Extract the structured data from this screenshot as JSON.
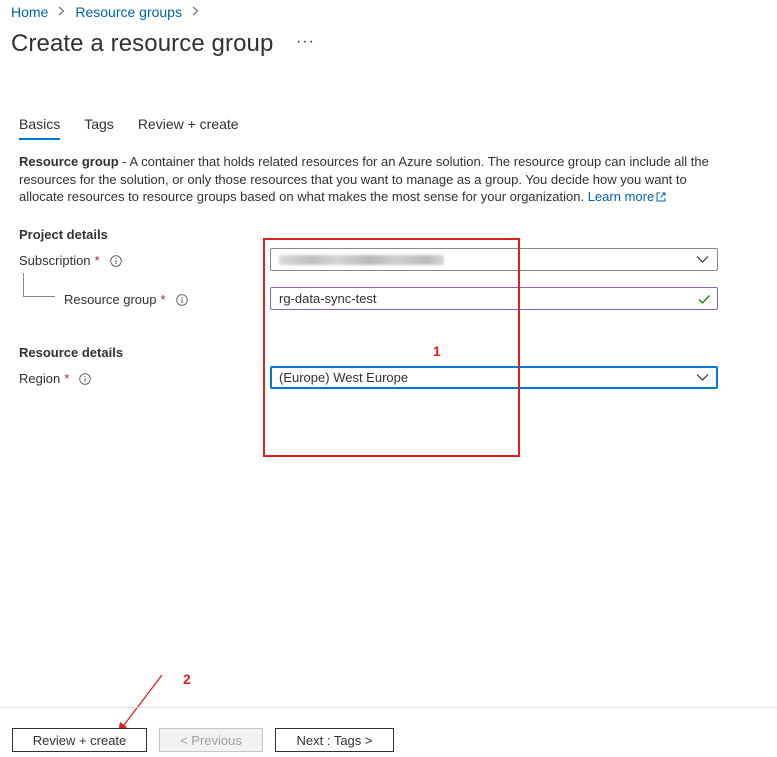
{
  "breadcrumb": {
    "items": [
      "Home",
      "Resource groups"
    ]
  },
  "page": {
    "title": "Create a resource group",
    "more": "···"
  },
  "tabs": [
    {
      "label": "Basics",
      "active": true
    },
    {
      "label": "Tags",
      "active": false
    },
    {
      "label": "Review + create",
      "active": false
    }
  ],
  "description": {
    "term": "Resource group",
    "text": " - A container that holds related resources for an Azure solution. The resource group can include all the resources for the solution, or only those resources that you want to manage as a group. You decide how you want to allocate resources to resource groups based on what makes the most sense for your organization. ",
    "link": "Learn more"
  },
  "project_details": {
    "heading": "Project details",
    "subscription": {
      "label": "Subscription",
      "required_mark": "*",
      "value_redacted": true
    },
    "resource_group": {
      "label": "Resource group",
      "required_mark": "*",
      "value": "rg-data-sync-test",
      "valid": true
    }
  },
  "resource_details": {
    "heading": "Resource details",
    "region": {
      "label": "Region",
      "required_mark": "*",
      "value": "(Europe) West Europe"
    }
  },
  "annotations": {
    "box_number": "1",
    "arrow_number": "2",
    "color": "#e0201b"
  },
  "footer": {
    "review_create": "Review + create",
    "previous": "< Previous",
    "next": "Next : Tags >"
  },
  "colors": {
    "link": "#0063b1",
    "accent": "#0078d4",
    "required": "#a4262c",
    "valid": "#107c10"
  }
}
